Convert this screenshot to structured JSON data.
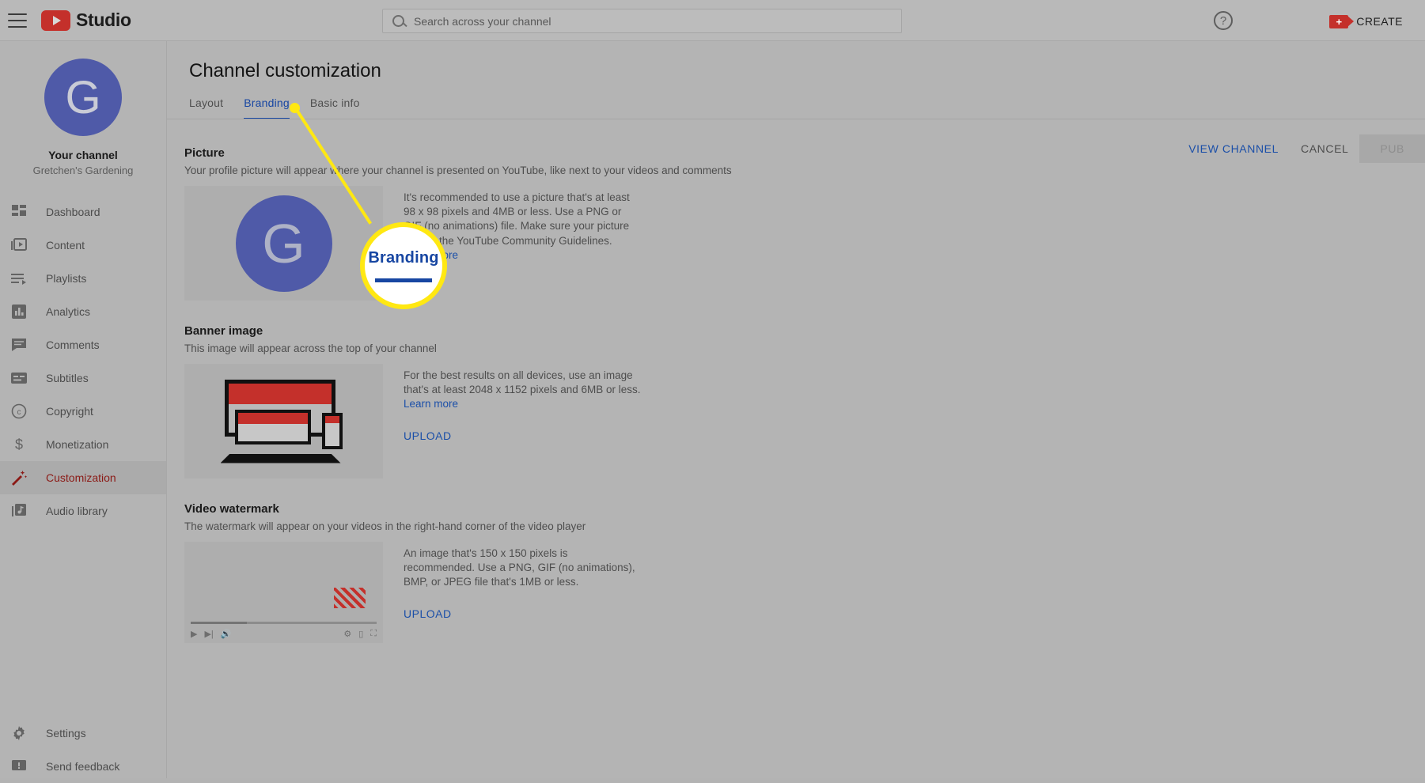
{
  "header": {
    "menu_icon": "hamburger-icon",
    "logo_text": "Studio",
    "search_placeholder": "Search across your channel",
    "search_value": "",
    "help_glyph": "?",
    "create_label": "CREATE",
    "create_icon": "video-camera-plus-icon"
  },
  "sidebar": {
    "avatar_letter": "G",
    "channel_heading": "Your channel",
    "channel_name": "Gretchen's Gardening",
    "items": [
      {
        "label": "Dashboard",
        "icon": "dashboard-icon",
        "active": false
      },
      {
        "label": "Content",
        "icon": "video-library-icon",
        "active": false
      },
      {
        "label": "Playlists",
        "icon": "playlist-icon",
        "active": false
      },
      {
        "label": "Analytics",
        "icon": "analytics-bar-icon",
        "active": false
      },
      {
        "label": "Comments",
        "icon": "comment-bubble-icon",
        "active": false
      },
      {
        "label": "Subtitles",
        "icon": "subtitles-icon",
        "active": false
      },
      {
        "label": "Copyright",
        "icon": "copyright-icon",
        "active": false
      },
      {
        "label": "Monetization",
        "icon": "dollar-sign-icon",
        "active": false
      },
      {
        "label": "Customization",
        "icon": "magic-wand-icon",
        "active": true
      },
      {
        "label": "Audio library",
        "icon": "music-note-icon",
        "active": false
      }
    ],
    "bottom_items": [
      {
        "label": "Settings",
        "icon": "gear-icon"
      },
      {
        "label": "Send feedback",
        "icon": "feedback-icon"
      }
    ]
  },
  "main": {
    "page_title": "Channel customization",
    "tabs": [
      {
        "label": "Layout",
        "active": false
      },
      {
        "label": "Branding",
        "active": true
      },
      {
        "label": "Basic info",
        "active": false
      }
    ],
    "actions": {
      "view_channel": "VIEW CHANNEL",
      "cancel": "CANCEL",
      "publish": "PUB"
    },
    "sections": [
      {
        "title": "Picture",
        "description": "Your profile picture will appear where your channel is presented on YouTube, like next to your videos and comments",
        "info": "It's recommended to use a picture that's at least 98 x 98 pixels and 4MB or less. Use a PNG or GIF (no animations) file. Make sure your picture follows the YouTube Community Guidelines.",
        "link": "Learn more",
        "avatar_letter": "G"
      },
      {
        "title": "Banner image",
        "description": "This image will appear across the top of your channel",
        "info": "For the best results on all devices, use an image that's at least 2048 x 1152 pixels and 6MB or less.",
        "link": "Learn more",
        "upload": "UPLOAD"
      },
      {
        "title": "Video watermark",
        "description": "The watermark will appear on your videos in the right-hand corner of the video player",
        "info": "An image that's 150 x 150 pixels is recommended. Use a PNG, GIF (no animations), BMP, or JPEG file that's 1MB or less.",
        "upload": "UPLOAD"
      }
    ]
  },
  "annotation": {
    "callout_label": "Branding",
    "highlight_color": "#ffe812",
    "accent_blue": "#1746a2"
  }
}
